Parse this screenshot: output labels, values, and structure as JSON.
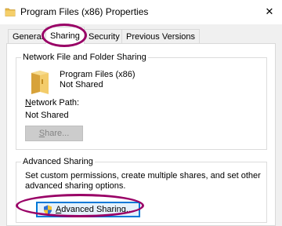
{
  "window": {
    "title": "Program Files (x86) Properties",
    "close_glyph": "✕"
  },
  "tabs": [
    {
      "label": "General",
      "active": false
    },
    {
      "label": "Sharing",
      "active": true
    },
    {
      "label": "Security",
      "active": false
    },
    {
      "label": "Previous Versions",
      "active": false
    }
  ],
  "network_sharing": {
    "group_title": "Network File and Folder Sharing",
    "folder_name": "Program Files (x86)",
    "status": "Not Shared",
    "network_path_label_first": "N",
    "network_path_label_rest": "etwork Path:",
    "network_path_value": "Not Shared",
    "share_button_first": "S",
    "share_button_rest": "hare..."
  },
  "advanced_sharing": {
    "group_title": "Advanced Sharing",
    "description_line1": "Set custom permissions, create multiple shares, and set other",
    "description_line2": "advanced sharing options.",
    "button_first": "A",
    "button_rest": "dvanced Sharing..."
  },
  "colors": {
    "highlight_ring": "#990066",
    "folder_yellow": "#e8b84a",
    "default_button_border": "#0078d7"
  }
}
